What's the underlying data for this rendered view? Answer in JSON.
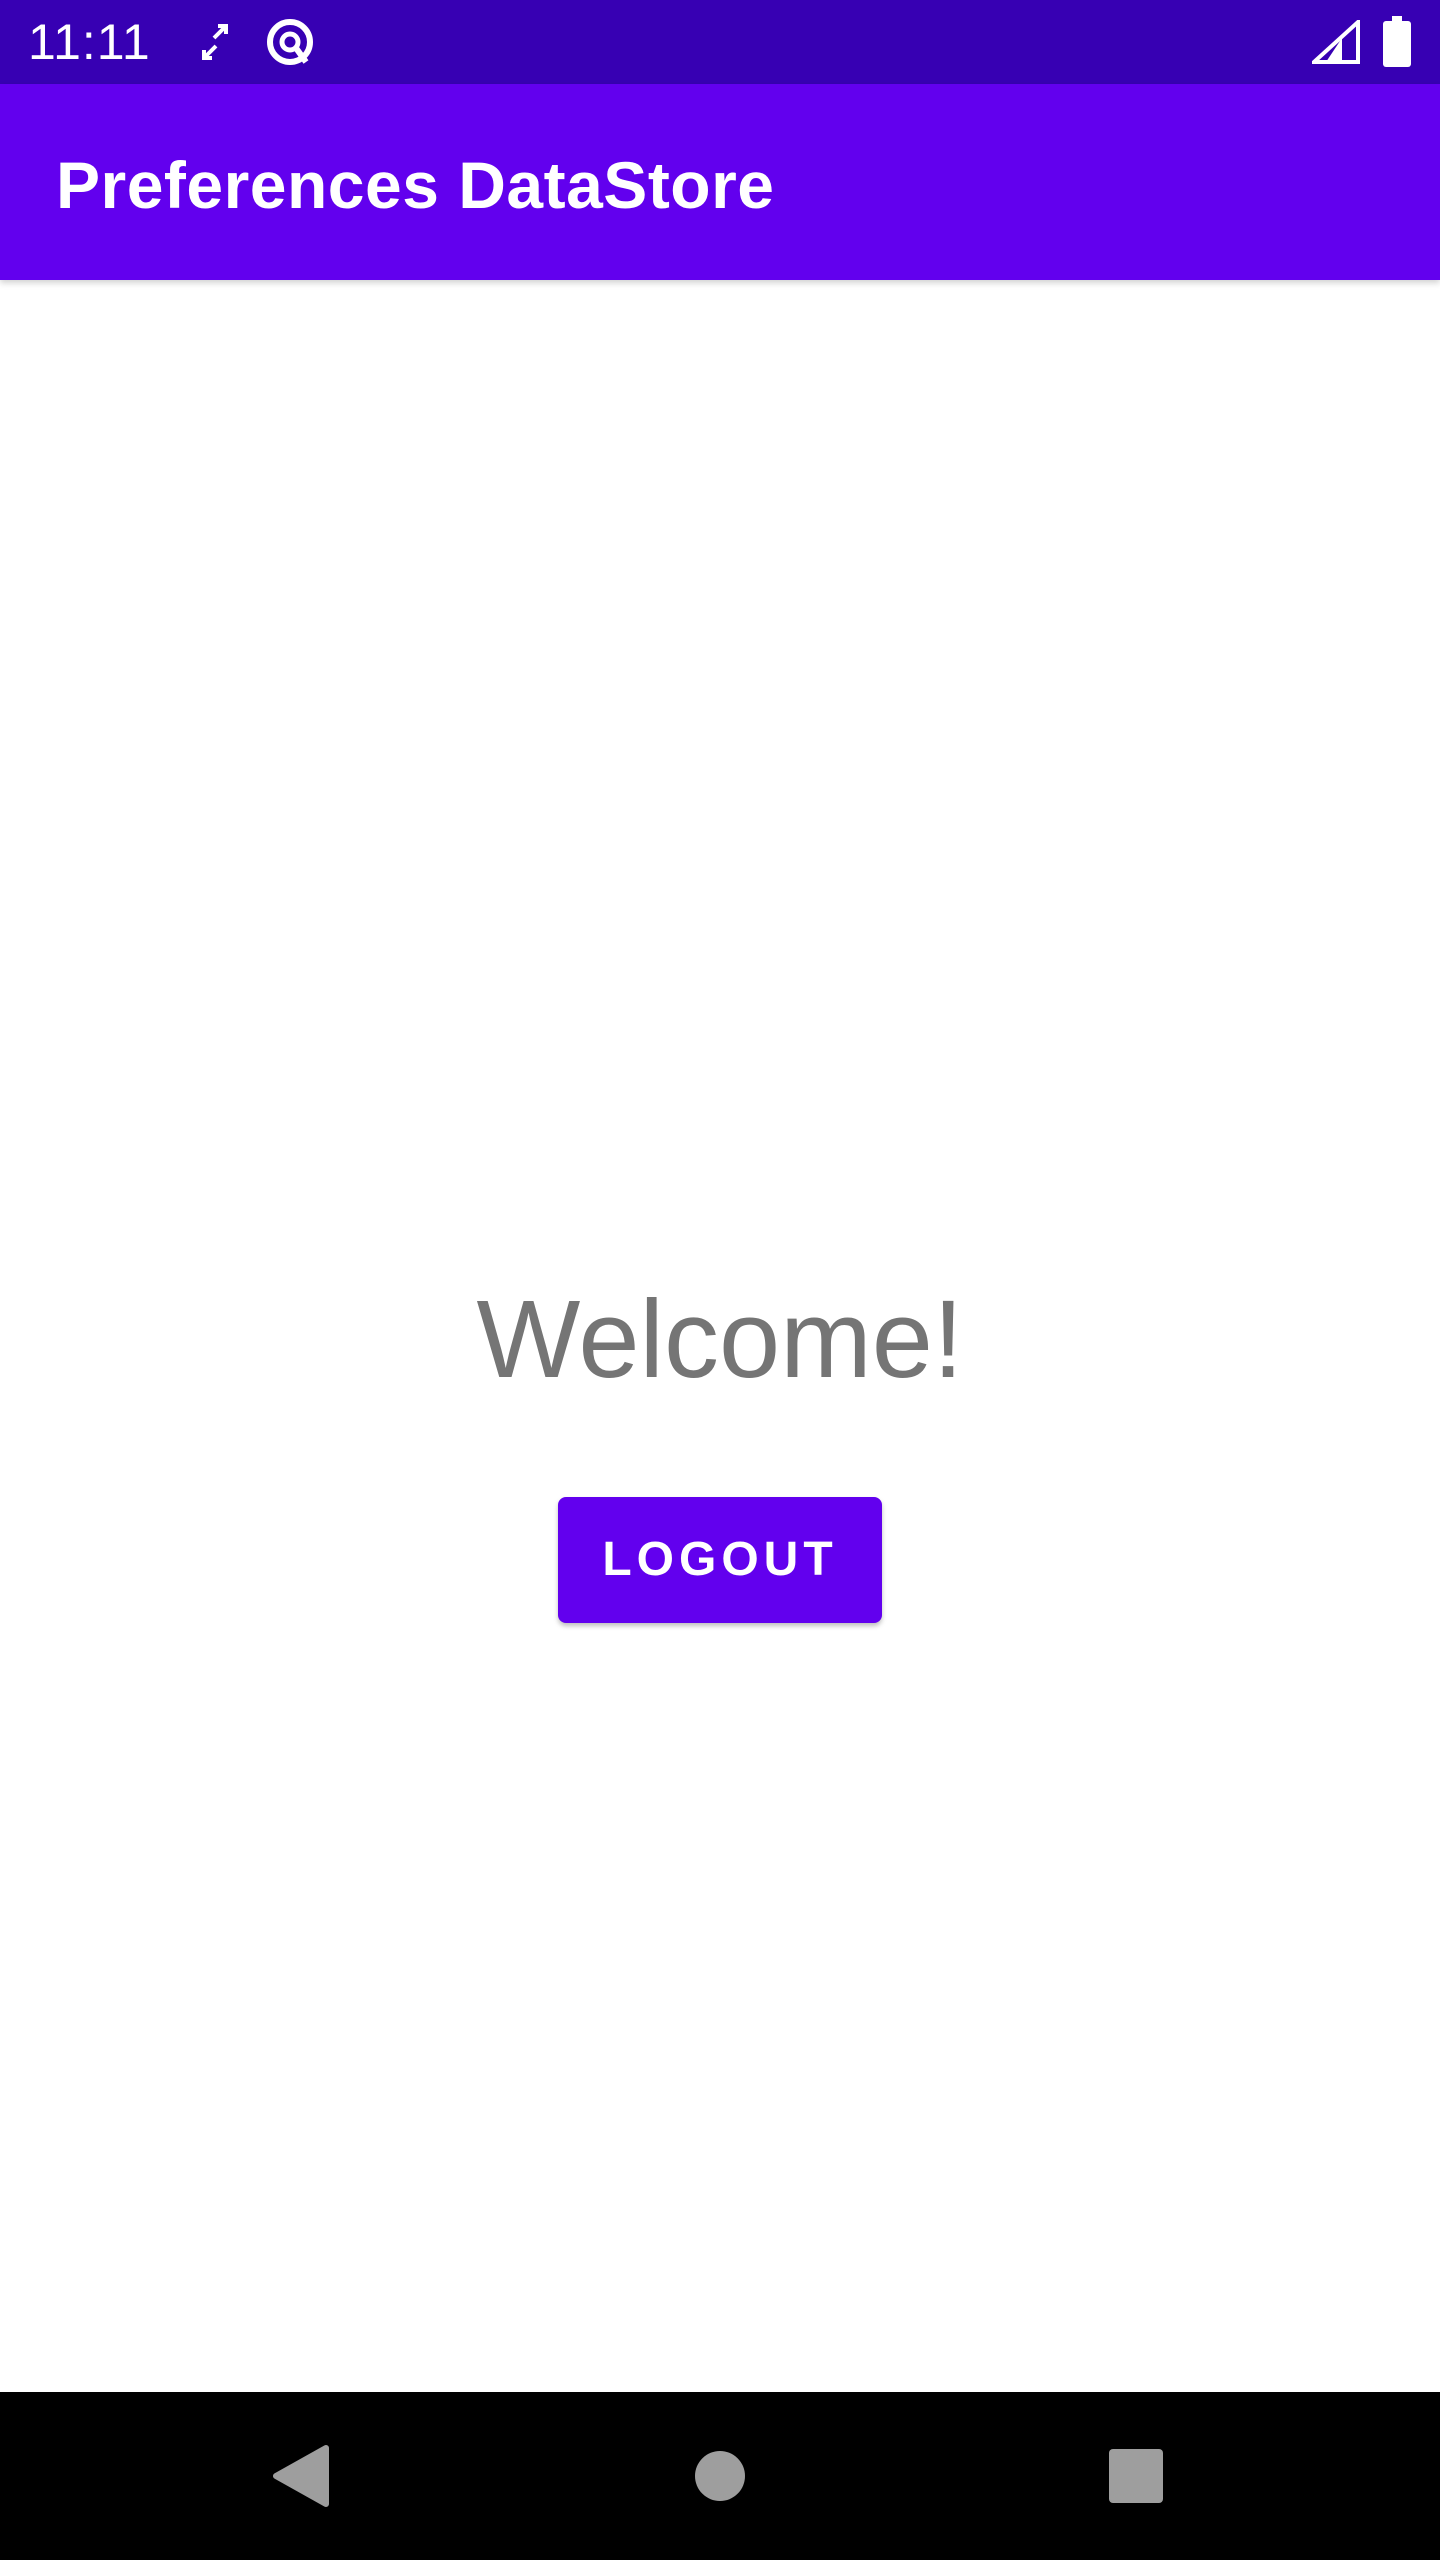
{
  "status_bar": {
    "time": "11:11",
    "background": "#3700b3",
    "icons": [
      "sync-icon",
      "data-saver-icon",
      "cell-signal-icon",
      "battery-icon"
    ]
  },
  "app_bar": {
    "title": "Preferences DataStore",
    "background": "#6200ee"
  },
  "main": {
    "welcome_text": "Welcome!",
    "logout_label": "LOGOUT",
    "button_color": "#6200ee"
  },
  "nav_bar": {
    "icons": [
      "back-icon",
      "home-icon",
      "recents-icon"
    ]
  }
}
